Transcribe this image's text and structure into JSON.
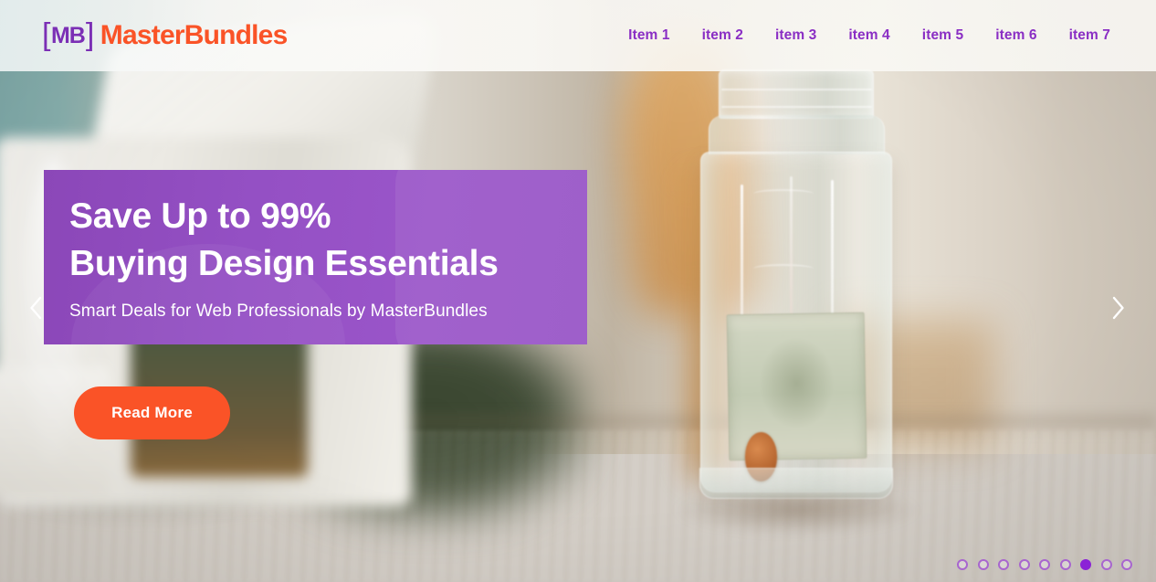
{
  "header": {
    "logo": {
      "bracket_open": "[",
      "monogram": "MB",
      "bracket_close": "]",
      "wordmark": "MasterBundles",
      "monogram_color": "#7b2fb5",
      "wordmark_color": "#fa5327"
    },
    "nav": {
      "items": [
        {
          "label": "Item 1"
        },
        {
          "label": "item 2"
        },
        {
          "label": "item 3"
        },
        {
          "label": "item 4"
        },
        {
          "label": "item 5"
        },
        {
          "label": "item 6"
        },
        {
          "label": "item 7"
        }
      ],
      "link_color": "#8a2ec4"
    }
  },
  "hero": {
    "title": "Save Up to 99%\nBuying Design Essentials",
    "subtitle": "Smart Deals for Web Professionals by MasterBundles",
    "band_color": "#9450c4",
    "cta": {
      "label": "Read More",
      "color": "#fa5327"
    }
  },
  "carousel": {
    "prev_icon": "chevron-left-icon",
    "next_icon": "chevron-right-icon",
    "total_slides": 9,
    "active_slide": 7,
    "dot_color": "#a866cf",
    "dot_active_color": "#8b23d6"
  },
  "background": {
    "description": "blurred kitchen photo with glass mason jar holding a dollar bill and a penny on a wooden table"
  }
}
